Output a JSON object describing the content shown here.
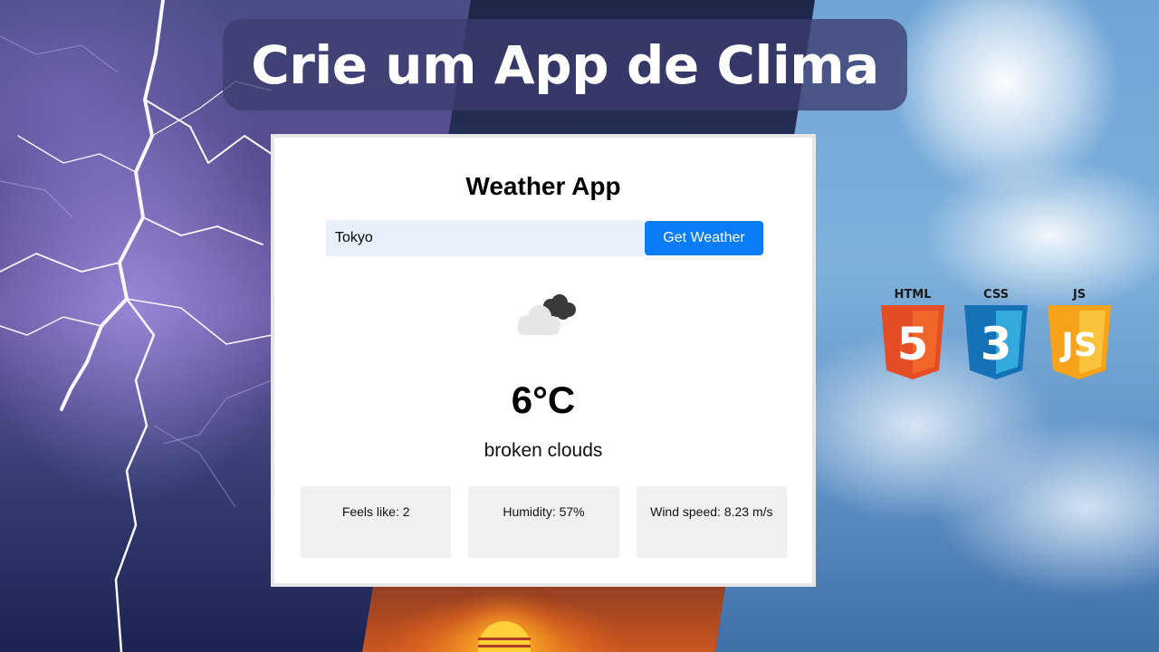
{
  "banner": {
    "title": "Crie um App de Clima"
  },
  "app": {
    "title": "Weather App",
    "search": {
      "value": "Tokyo",
      "placeholder": "",
      "button_label": "Get Weather"
    },
    "weather": {
      "icon": "broken-clouds-icon",
      "temperature": "6°C",
      "description": "broken clouds"
    },
    "details": [
      {
        "text": "Feels like: 2"
      },
      {
        "text": "Humidity: 57%"
      },
      {
        "text": "Wind speed: 8.23 m/s"
      }
    ]
  },
  "tech_logos": [
    {
      "label": "HTML",
      "glyph": "5",
      "icon": "html5-icon",
      "color": "#e44d26"
    },
    {
      "label": "CSS",
      "glyph": "3",
      "icon": "css3-icon",
      "color": "#1572b6"
    },
    {
      "label": "JS",
      "glyph": "JS",
      "icon": "js-icon",
      "color": "#f7a21b"
    }
  ],
  "colors": {
    "accent": "#0a7cf5",
    "input_bg": "#e8f0fb",
    "detail_bg": "#f0f0f0"
  }
}
